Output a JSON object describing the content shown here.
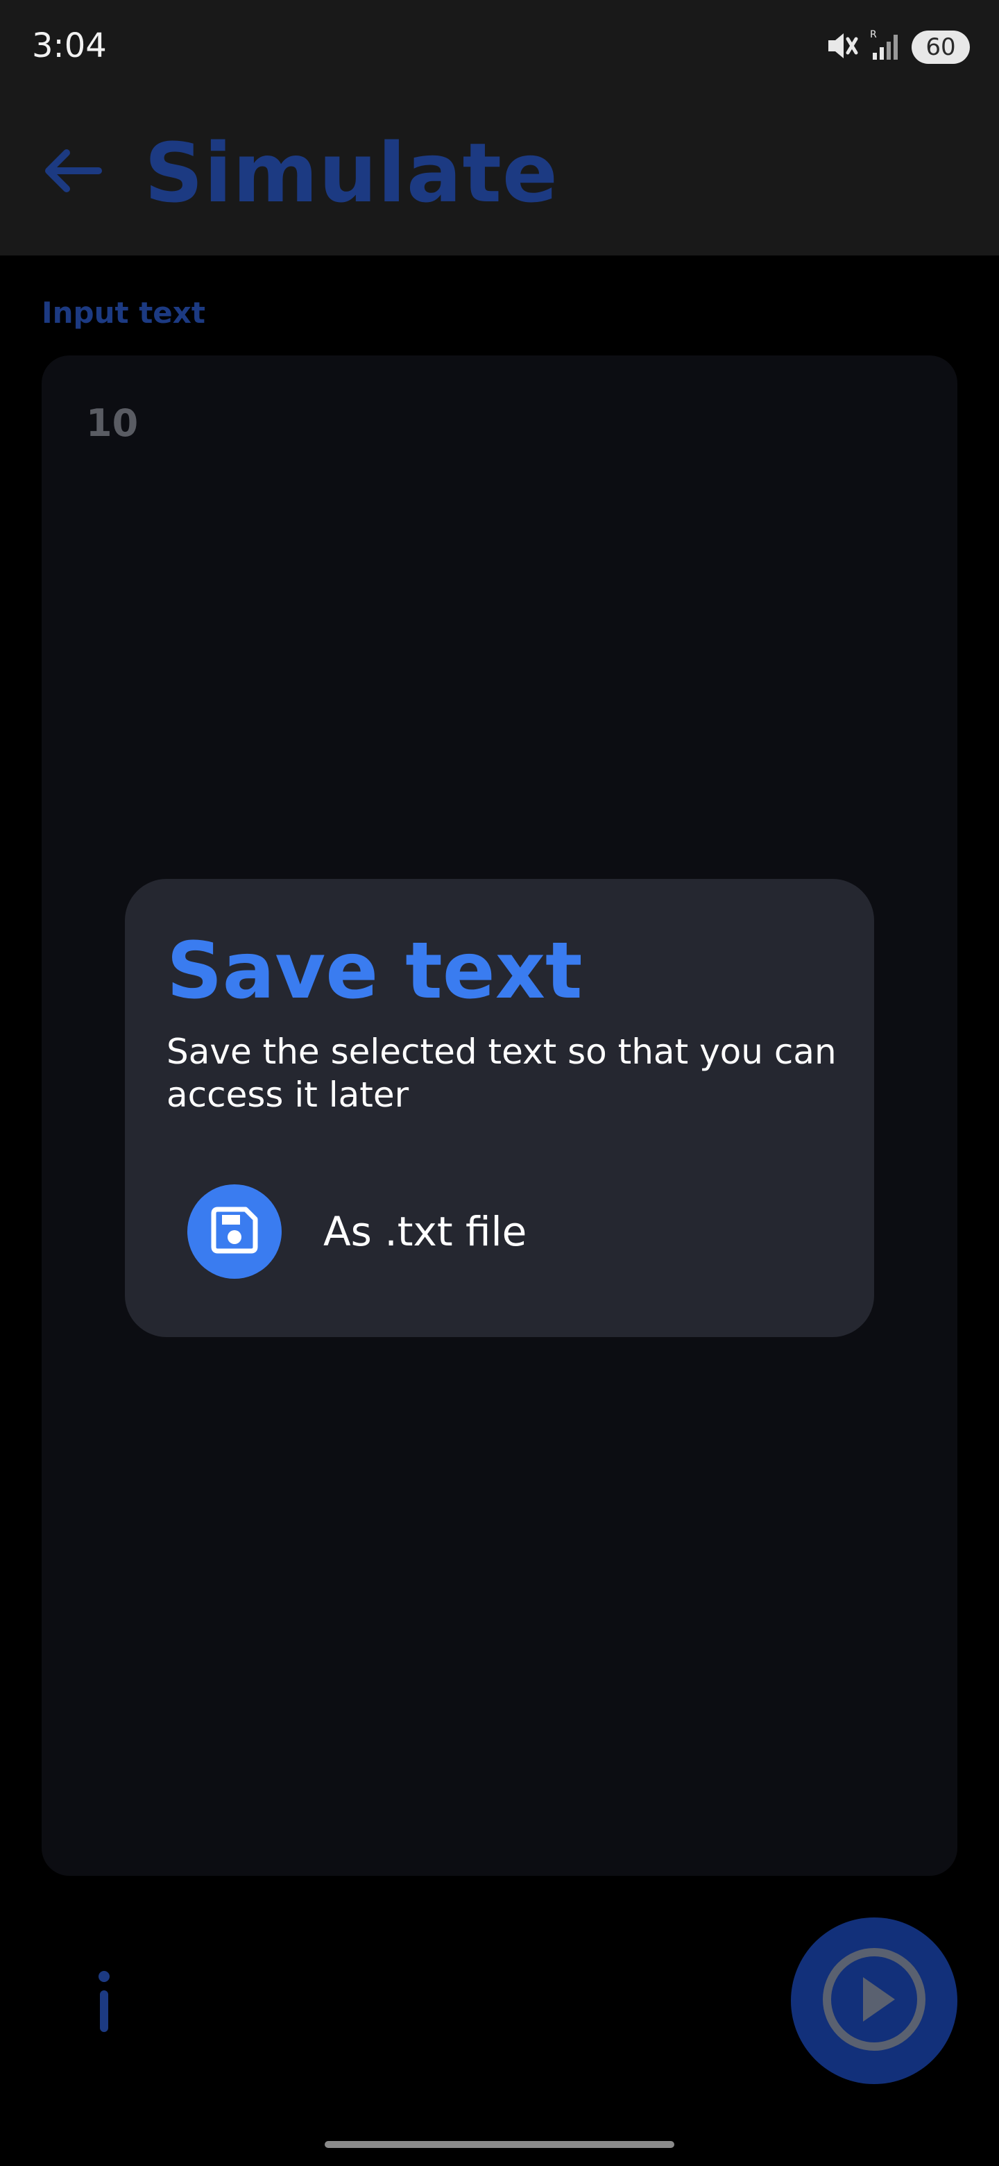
{
  "status_bar": {
    "time": "3:04",
    "battery": "60",
    "icons": [
      "mute-icon",
      "signal-icon",
      "battery-icon"
    ]
  },
  "app_bar": {
    "title": "Simulate",
    "back_icon": "arrow-left-icon"
  },
  "input": {
    "label": "Input text",
    "value": "10"
  },
  "dialog": {
    "title": "Save text",
    "description": "Save the selected text so that you can access it later",
    "options": [
      {
        "label": "As .txt file",
        "icon": "floppy-disk-icon"
      }
    ]
  },
  "bottom": {
    "info_icon": "info-icon",
    "fab_icon": "play-icon"
  },
  "colors": {
    "accent": "#3a7cf0",
    "dim_accent": "#1c3a82",
    "dialog_bg": "#252730",
    "card_bg": "#0c0d12",
    "bar_bg": "#191919"
  }
}
